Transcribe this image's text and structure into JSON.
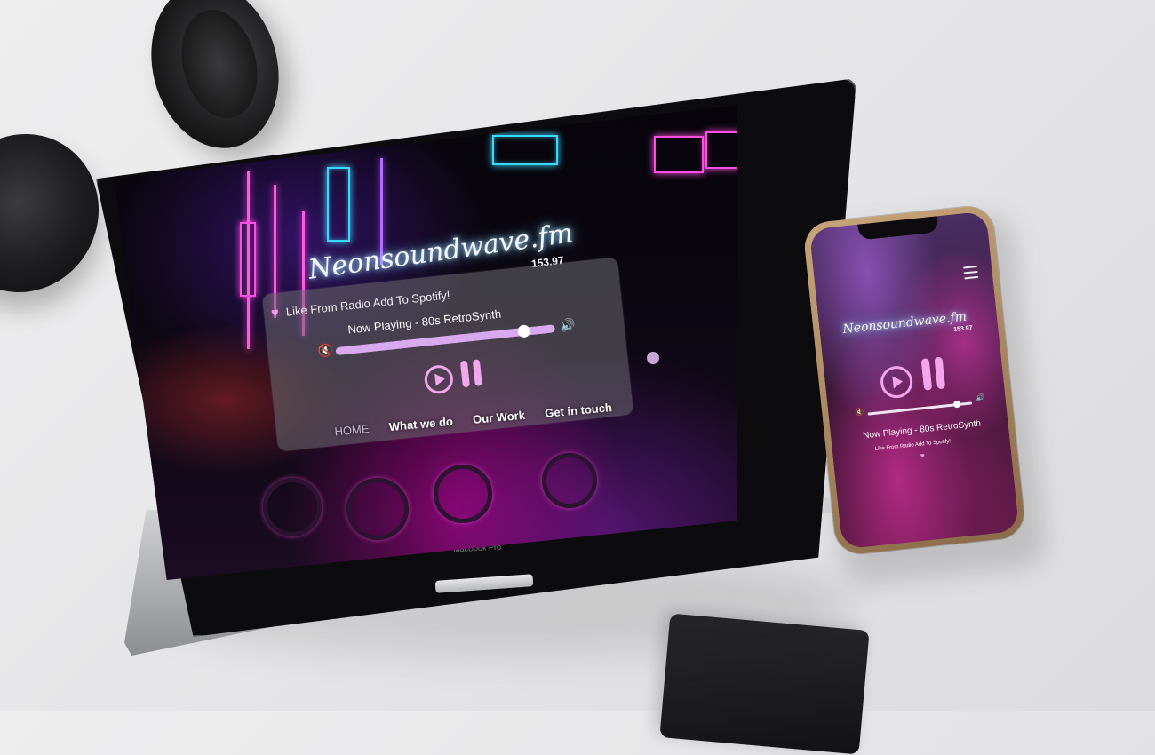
{
  "site": {
    "logo_text": "Neonsoundwave.fm",
    "frequency": "153.97"
  },
  "player": {
    "like_text": "Like From Radio Add To Spotify!",
    "now_playing": "Now Playing - 80s RetroSynth",
    "volume_fraction": 0.86
  },
  "nav": {
    "items": [
      "HOME",
      "What we do",
      "Our Work",
      "Get in touch"
    ]
  },
  "device": {
    "laptop_brand": "MacBook Pro"
  },
  "colors": {
    "accent_pink": "#f2a6ec",
    "slider_lilac": "#d8a9ef",
    "neon_blue": "#3ad7ff",
    "neon_pink": "#ff4ee0"
  },
  "icons": [
    "heart-icon",
    "mute-icon",
    "volume-icon",
    "play-icon",
    "pause-icon",
    "menu-icon"
  ]
}
